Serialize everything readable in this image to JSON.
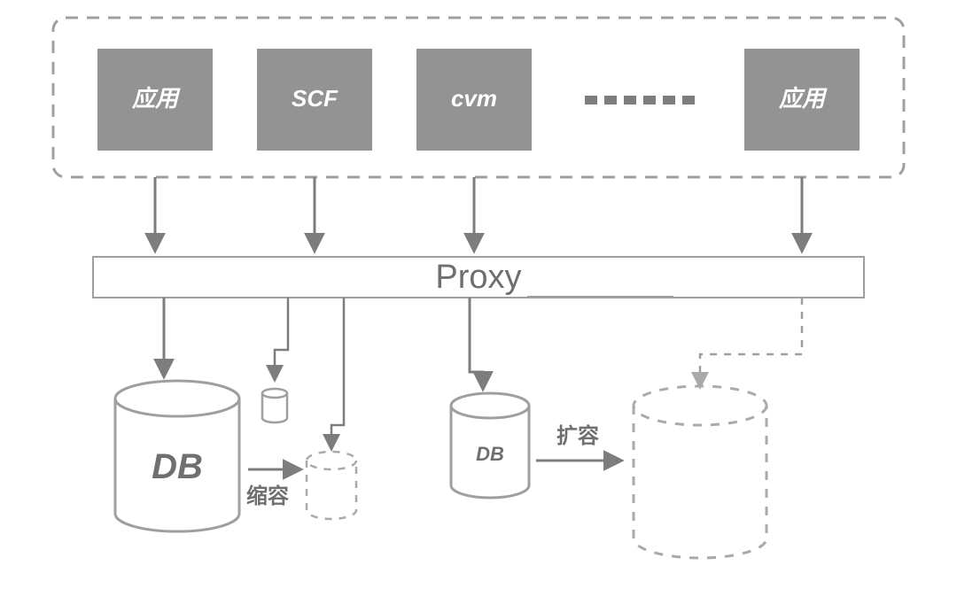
{
  "nodes": {
    "app1": {
      "label": "应用"
    },
    "scf": {
      "label": "SCF"
    },
    "cvm": {
      "label": "cvm"
    },
    "app2": {
      "label": "应用"
    },
    "proxy": {
      "label": "Proxy"
    },
    "db_big": {
      "label": "DB"
    },
    "db_mid": {
      "label": "DB"
    }
  },
  "annotations": {
    "shrink": {
      "label": "缩容"
    },
    "expand": {
      "label": "扩容"
    }
  }
}
